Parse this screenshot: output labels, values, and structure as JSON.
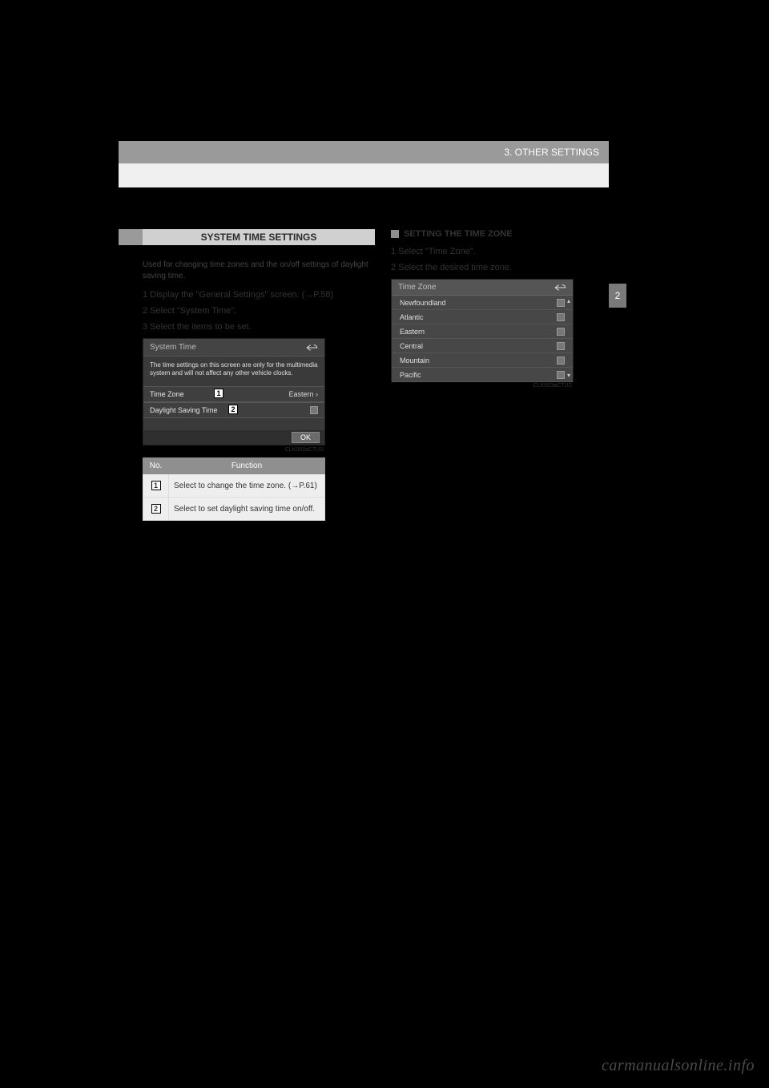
{
  "header": {
    "breadcrumb": "3. OTHER SETTINGS"
  },
  "side_tab": "2",
  "left": {
    "section_title": "SYSTEM TIME SETTINGS",
    "notice": "Used for changing time zones and the on/off settings of daylight saving time.",
    "step1": "1 Display the \"General Settings\" screen. (→P.58)",
    "step2": "2 Select \"System Time\".",
    "step3": "3 Select the items to be set.",
    "screen1": {
      "title": "System Time",
      "note": "The time settings on this screen are only for the multimedia system and will not affect any other vehicle clocks.",
      "row1_label": "Time Zone",
      "row1_value": "Eastern ›",
      "row2_label": "Daylight Saving Time",
      "marker1": "1",
      "marker2": "2",
      "ok": "OK",
      "img_label": "CLK002aCTUS"
    },
    "table": {
      "h_no": "No.",
      "h_func": "Function",
      "r1_no": "1",
      "r1_func": "Select to change the time zone. (→P.61)",
      "r2_no": "2",
      "r2_func": "Select to set daylight saving time on/off."
    }
  },
  "right": {
    "bullet_title": "SETTING THE TIME ZONE",
    "step1": "1 Select \"Time Zone\".",
    "step2": "2 Select the desired time zone.",
    "screen2": {
      "title": "Time Zone",
      "items": [
        "Newfoundland",
        "Atlantic",
        "Eastern",
        "Central",
        "Mountain",
        "Pacific"
      ],
      "img_label": "CLK003aCTUS"
    }
  },
  "watermark": "carmanualsonline.info"
}
